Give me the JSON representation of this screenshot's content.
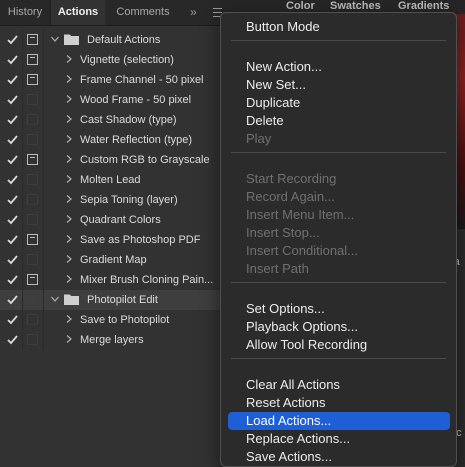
{
  "panel_tabs": [
    "History",
    "Actions",
    "Comments"
  ],
  "right_tabs": [
    "Color",
    "Swatches",
    "Gradients"
  ],
  "right_peek_top": "ra",
  "right_peek_bottom": "nc",
  "actions": [
    {
      "label": "Default Actions",
      "type": "set",
      "dialog": true
    },
    {
      "label": "Vignette (selection)",
      "type": "action",
      "dialog": true
    },
    {
      "label": "Frame Channel - 50 pixel",
      "type": "action",
      "dialog": true
    },
    {
      "label": "Wood Frame - 50 pixel",
      "type": "action",
      "dialog": false
    },
    {
      "label": "Cast Shadow (type)",
      "type": "action",
      "dialog": false
    },
    {
      "label": "Water Reflection (type)",
      "type": "action",
      "dialog": false
    },
    {
      "label": "Custom RGB to Grayscale",
      "type": "action",
      "dialog": true
    },
    {
      "label": "Molten Lead",
      "type": "action",
      "dialog": false
    },
    {
      "label": "Sepia Toning (layer)",
      "type": "action",
      "dialog": false
    },
    {
      "label": "Quadrant Colors",
      "type": "action",
      "dialog": false
    },
    {
      "label": "Save as Photoshop PDF",
      "type": "action",
      "dialog": true
    },
    {
      "label": "Gradient Map",
      "type": "action",
      "dialog": false
    },
    {
      "label": "Mixer Brush Cloning Pain...",
      "type": "action",
      "dialog": true
    },
    {
      "label": "Photopilot Edit",
      "type": "set",
      "dialog": false,
      "selected": true
    },
    {
      "label": "Save to Photopilot",
      "type": "action",
      "dialog": false
    },
    {
      "label": "Merge layers",
      "type": "action",
      "dialog": false
    }
  ],
  "menu_groups": [
    [
      {
        "label": "Button Mode"
      }
    ],
    [
      {
        "label": "New Action..."
      },
      {
        "label": "New Set..."
      },
      {
        "label": "Duplicate"
      },
      {
        "label": "Delete"
      },
      {
        "label": "Play",
        "disabled": true
      }
    ],
    [
      {
        "label": "Start Recording",
        "disabled": true
      },
      {
        "label": "Record Again...",
        "disabled": true
      },
      {
        "label": "Insert Menu Item...",
        "disabled": true
      },
      {
        "label": "Insert Stop...",
        "disabled": true
      },
      {
        "label": "Insert Conditional...",
        "disabled": true
      },
      {
        "label": "Insert Path",
        "disabled": true
      }
    ],
    [
      {
        "label": "Set Options..."
      },
      {
        "label": "Playback Options..."
      },
      {
        "label": "Allow Tool Recording"
      }
    ],
    [
      {
        "label": "Clear All Actions"
      },
      {
        "label": "Reset Actions"
      },
      {
        "label": "Load Actions...",
        "highlighted": true
      },
      {
        "label": "Replace Actions..."
      },
      {
        "label": "Save Actions..."
      }
    ]
  ]
}
